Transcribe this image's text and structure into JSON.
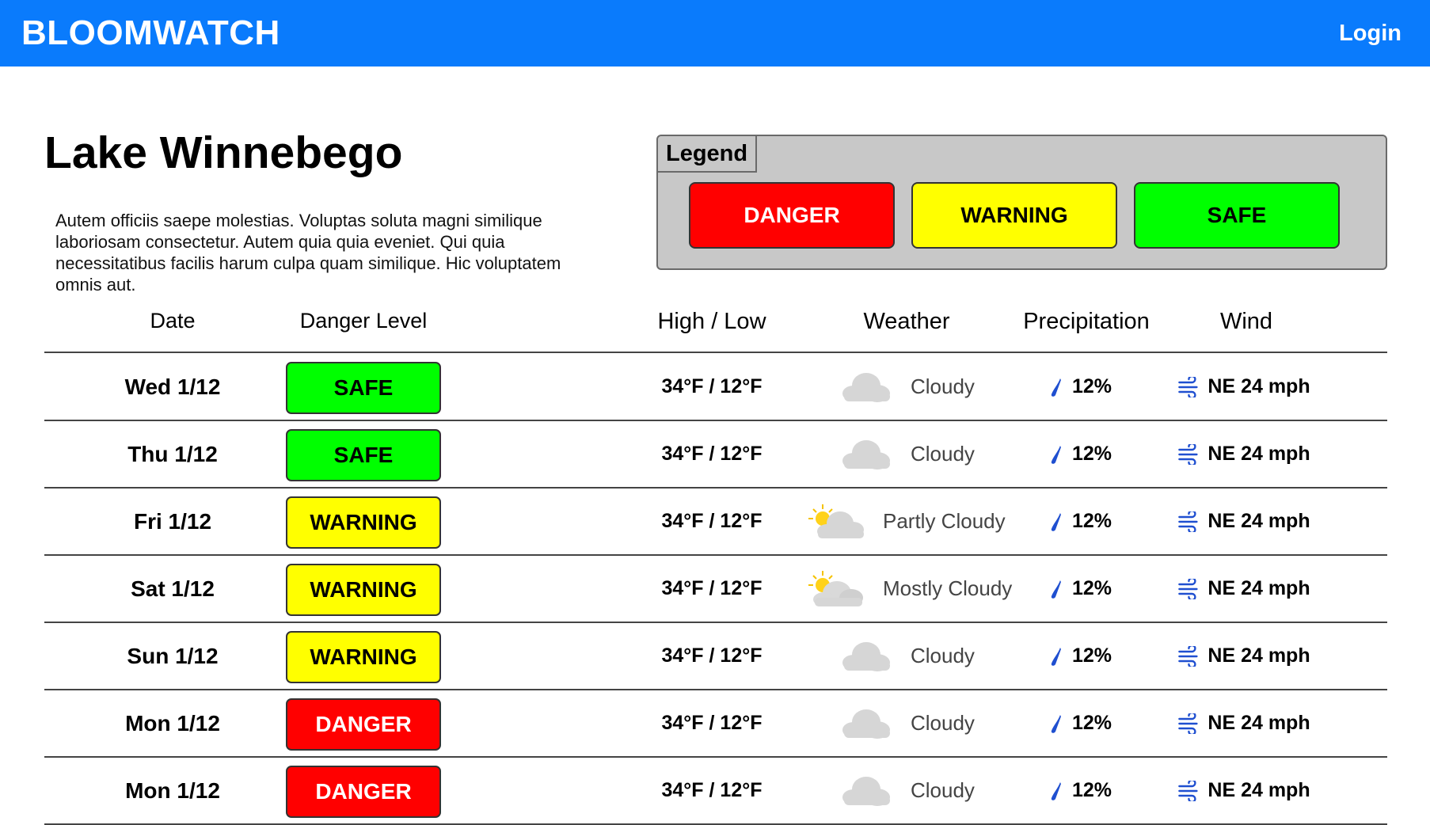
{
  "header": {
    "brand": "BLOOMWATCH",
    "login_label": "Login"
  },
  "page": {
    "title": "Lake Winnebego",
    "description": "Autem officiis saepe molestias. Voluptas soluta magni similique laboriosam consectetur. Autem quia quia eveniet. Qui quia necessitatibus facilis harum culpa quam similique. Hic voluptatem omnis aut."
  },
  "legend": {
    "title": "Legend",
    "items": [
      {
        "label": "DANGER",
        "color": "#ff0000",
        "text_color": "#ffffff"
      },
      {
        "label": "WARNING",
        "color": "#ffff00",
        "text_color": "#000000"
      },
      {
        "label": "SAFE",
        "color": "#00ff00",
        "text_color": "#000000"
      }
    ]
  },
  "table": {
    "headers": {
      "date": "Date",
      "danger_level": "Danger Level",
      "high_low": "High / Low",
      "weather": "Weather",
      "precipitation": "Precipitation",
      "wind": "Wind"
    },
    "rows": [
      {
        "date": "Wed 1/12",
        "level": "SAFE",
        "high_low": "34°F / 12°F",
        "weather": "Cloudy",
        "weather_icon": "cloud-icon",
        "precip": "12%",
        "wind": "NE 24 mph"
      },
      {
        "date": "Thu 1/12",
        "level": "SAFE",
        "high_low": "34°F / 12°F",
        "weather": "Cloudy",
        "weather_icon": "cloud-icon",
        "precip": "12%",
        "wind": "NE 24 mph"
      },
      {
        "date": "Fri 1/12",
        "level": "WARNING",
        "high_low": "34°F / 12°F",
        "weather": "Partly Cloudy",
        "weather_icon": "partly-cloudy-icon",
        "precip": "12%",
        "wind": "NE 24 mph"
      },
      {
        "date": "Sat 1/12",
        "level": "WARNING",
        "high_low": "34°F / 12°F",
        "weather": "Mostly Cloudy",
        "weather_icon": "mostly-cloudy-icon",
        "precip": "12%",
        "wind": "NE 24 mph"
      },
      {
        "date": "Sun 1/12",
        "level": "WARNING",
        "high_low": "34°F / 12°F",
        "weather": "Cloudy",
        "weather_icon": "cloud-icon",
        "precip": "12%",
        "wind": "NE 24 mph"
      },
      {
        "date": "Mon 1/12",
        "level": "DANGER",
        "high_low": "34°F / 12°F",
        "weather": "Cloudy",
        "weather_icon": "cloud-icon",
        "precip": "12%",
        "wind": "NE 24 mph"
      },
      {
        "date": "Mon 1/12",
        "level": "DANGER",
        "high_low": "34°F / 12°F",
        "weather": "Cloudy",
        "weather_icon": "cloud-icon",
        "precip": "12%",
        "wind": "NE 24 mph"
      }
    ]
  },
  "colors": {
    "header_bg": "#0a7bfc",
    "danger": "#ff0000",
    "warning": "#ffff00",
    "safe": "#00ff00",
    "icon_blue": "#1f4fd0"
  }
}
